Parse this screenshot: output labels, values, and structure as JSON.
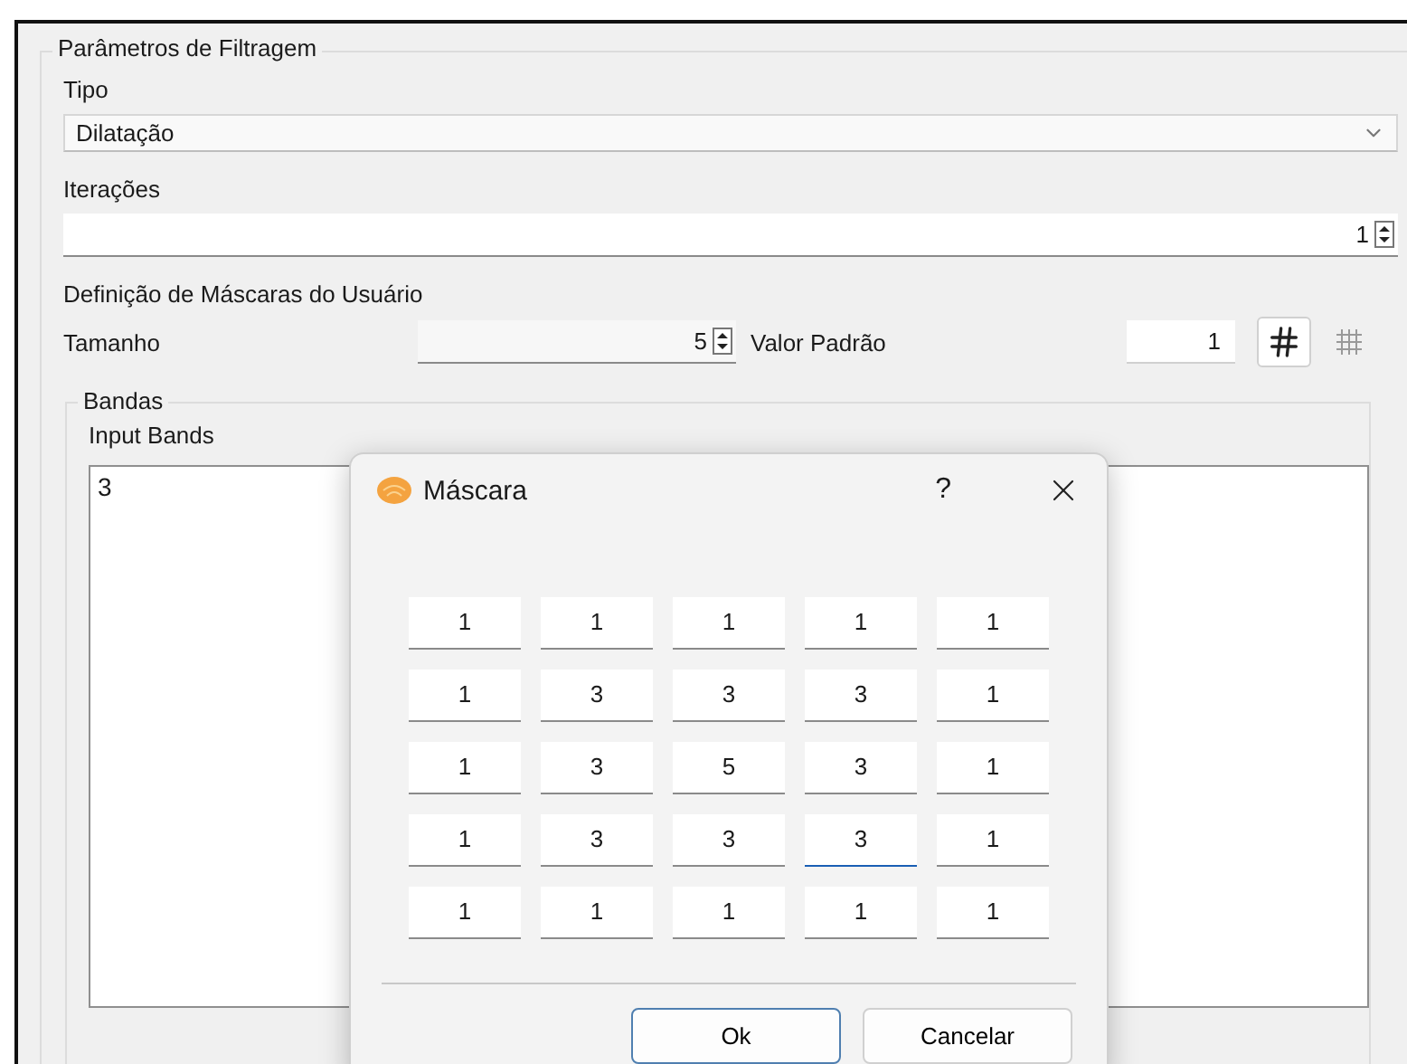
{
  "group_title": "Parâmetros de Filtragem",
  "type_label": "Tipo",
  "type_value": "Dilatação",
  "iterations_label": "Iterações",
  "iterations_value": "1",
  "mask_section_label": "Definição de Máscaras do Usuário",
  "size_label": "Tamanho",
  "size_value": "5",
  "default_value_label": "Valor Padrão",
  "default_value": "1",
  "bands": {
    "title": "Bandas",
    "input_label": "Input Bands",
    "input_value": "3"
  },
  "dialog": {
    "title": "Máscara",
    "help": "?",
    "mask": [
      [
        {
          "value": "1",
          "focused": false
        },
        {
          "value": "1",
          "focused": false
        },
        {
          "value": "1",
          "focused": false
        },
        {
          "value": "1",
          "focused": false
        },
        {
          "value": "1",
          "focused": false
        }
      ],
      [
        {
          "value": "1",
          "focused": false
        },
        {
          "value": "3",
          "focused": false
        },
        {
          "value": "3",
          "focused": false
        },
        {
          "value": "3",
          "focused": false
        },
        {
          "value": "1",
          "focused": false
        }
      ],
      [
        {
          "value": "1",
          "focused": false
        },
        {
          "value": "3",
          "focused": false
        },
        {
          "value": "5",
          "focused": false
        },
        {
          "value": "3",
          "focused": false
        },
        {
          "value": "1",
          "focused": false
        }
      ],
      [
        {
          "value": "1",
          "focused": false
        },
        {
          "value": "3",
          "focused": false
        },
        {
          "value": "3",
          "focused": false
        },
        {
          "value": "3",
          "focused": true
        },
        {
          "value": "1",
          "focused": false
        }
      ],
      [
        {
          "value": "1",
          "focused": false
        },
        {
          "value": "1",
          "focused": false
        },
        {
          "value": "1",
          "focused": false
        },
        {
          "value": "1",
          "focused": false
        },
        {
          "value": "1",
          "focused": false
        }
      ]
    ],
    "buttons": [
      {
        "label": "Ok",
        "default": true
      },
      {
        "label": "Cancelar",
        "default": false
      }
    ]
  }
}
